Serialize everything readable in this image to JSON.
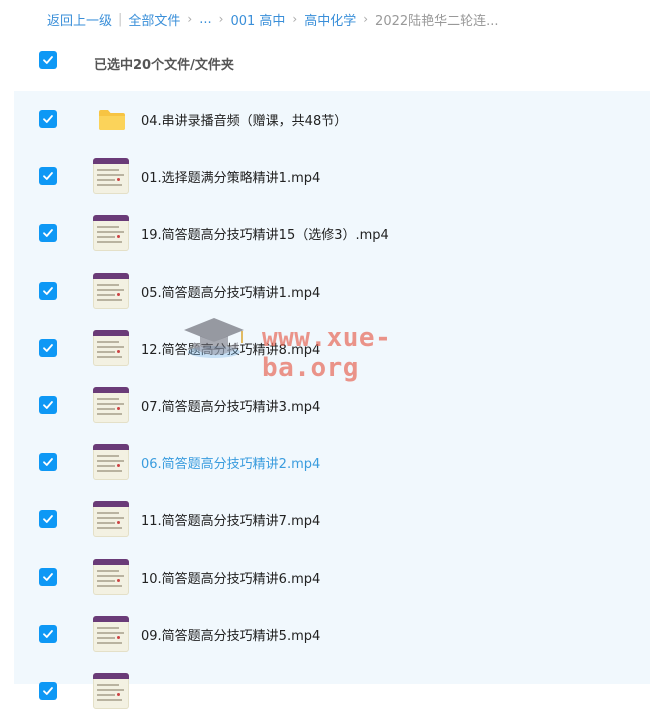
{
  "breadcrumb": {
    "back": "返回上一级",
    "all_files": "全部文件",
    "ellipsis": "...",
    "level1": "001 高中",
    "level2": "高中化学",
    "current": "2022陆艳华二轮连..."
  },
  "selection": {
    "text": "已选中20个文件/文件夹"
  },
  "watermark": {
    "text": "www.xue-ba.org"
  },
  "colors": {
    "accent": "#0e98f5",
    "link": "#3a8fd9",
    "list_bg": "#f1f8fd",
    "watermark": "#e86c5c"
  },
  "files": [
    {
      "name": "04.串讲录播音频（赠课，共48节）",
      "type": "folder",
      "icon": "folder-icon",
      "checked": true
    },
    {
      "name": "01.选择题满分策略精讲1.mp4",
      "type": "video",
      "icon": "video-thumbnail",
      "checked": true
    },
    {
      "name": "19.简答题高分技巧精讲15（选修3）.mp4",
      "type": "video",
      "icon": "video-thumbnail",
      "checked": true
    },
    {
      "name": "05.简答题高分技巧精讲1.mp4",
      "type": "video",
      "icon": "video-thumbnail",
      "checked": true
    },
    {
      "name": "12.简答题高分技巧精讲8.mp4",
      "type": "video",
      "icon": "video-thumbnail",
      "checked": true
    },
    {
      "name": "07.简答题高分技巧精讲3.mp4",
      "type": "video",
      "icon": "video-thumbnail",
      "checked": true
    },
    {
      "name": "06.简答题高分技巧精讲2.mp4",
      "type": "video",
      "icon": "video-thumbnail",
      "checked": true,
      "hovered": true
    },
    {
      "name": "11.简答题高分技巧精讲7.mp4",
      "type": "video",
      "icon": "video-thumbnail",
      "checked": true
    },
    {
      "name": "10.简答题高分技巧精讲6.mp4",
      "type": "video",
      "icon": "video-thumbnail",
      "checked": true
    },
    {
      "name": "09.简答题高分技巧精讲5.mp4",
      "type": "video",
      "icon": "video-thumbnail",
      "checked": true
    },
    {
      "name": "",
      "type": "video",
      "icon": "video-thumbnail",
      "checked": true
    }
  ]
}
